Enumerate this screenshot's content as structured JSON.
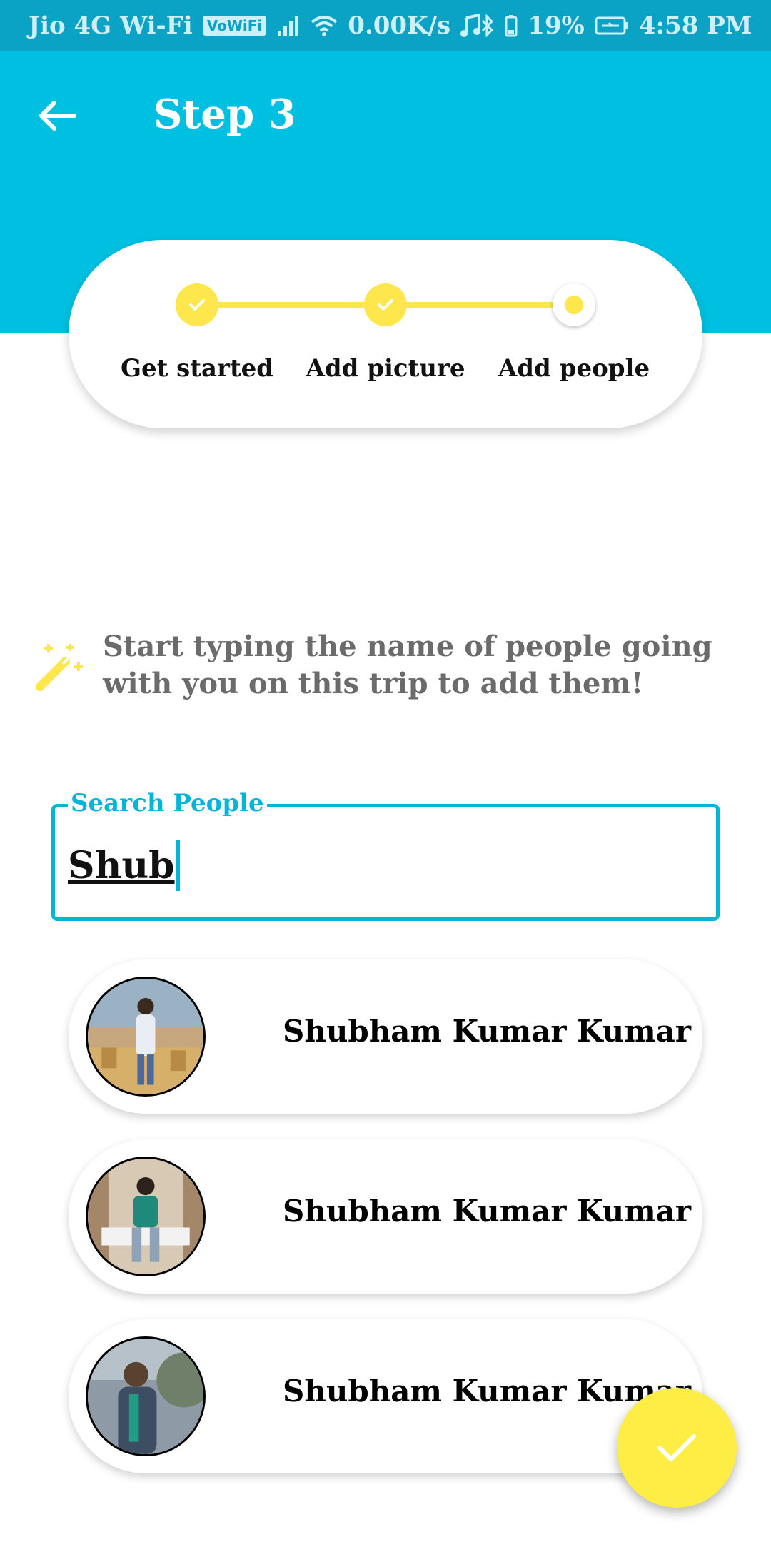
{
  "status_bar": {
    "carrier": "Jio 4G Wi-Fi",
    "vowifi": "VoWiFi",
    "network_speed": "0.00K/s",
    "battery": "19%",
    "time": "4:58 PM"
  },
  "header": {
    "title": "Step 3",
    "background_color": "#00c0e1"
  },
  "stepper": {
    "accent_color": "#fde74c",
    "steps": [
      {
        "label": "Get started",
        "state": "completed"
      },
      {
        "label": "Add picture",
        "state": "completed"
      },
      {
        "label": "Add people",
        "state": "current"
      }
    ]
  },
  "hint": {
    "icon": "magic-wand-icon",
    "text": "Start typing the name of people going with you on this trip to add them!"
  },
  "search": {
    "label": "Search People",
    "value": "Shub"
  },
  "results": [
    {
      "name": "Shubham Kumar Kumar",
      "avatar": "avatar-photo-1"
    },
    {
      "name": "Shubham Kumar Kumar",
      "avatar": "avatar-photo-2"
    },
    {
      "name": "Shubham Kumar Kumar",
      "avatar": "avatar-photo-3"
    }
  ],
  "fab": {
    "icon": "check-icon",
    "color": "#fded45"
  }
}
